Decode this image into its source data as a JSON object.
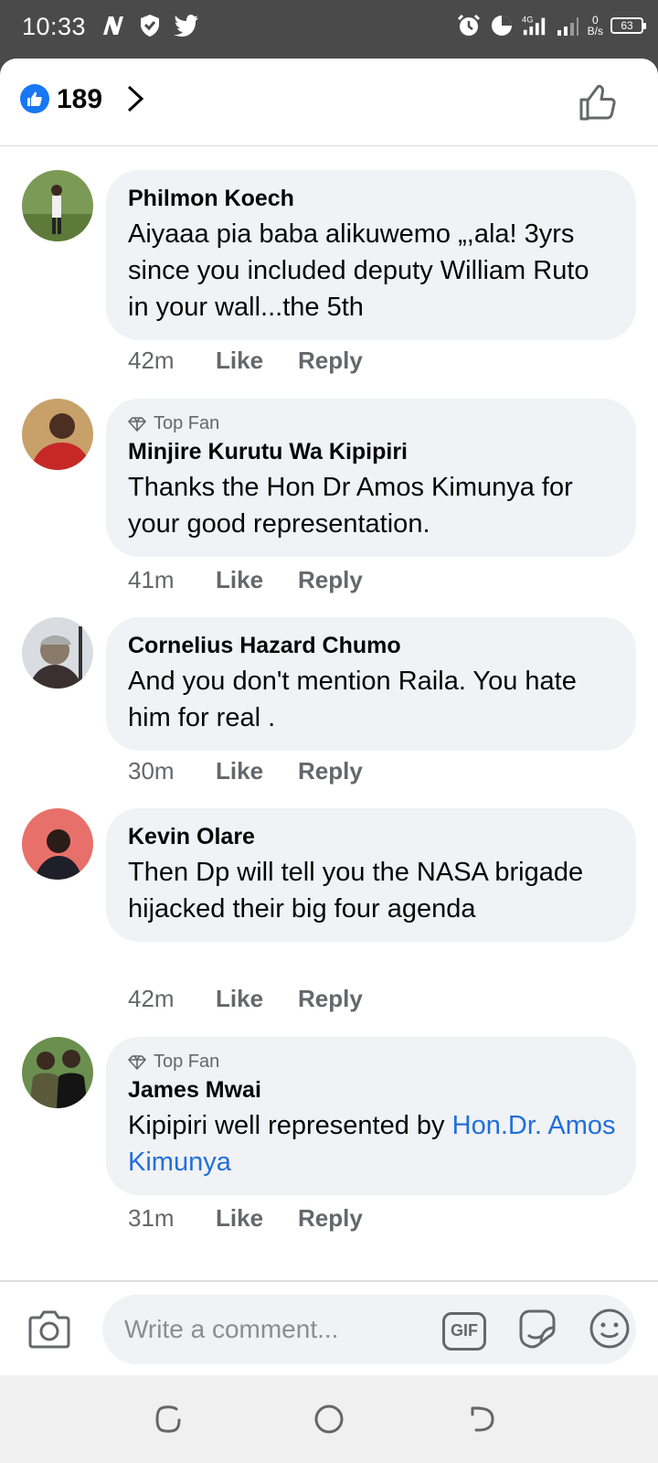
{
  "status_bar": {
    "time": "10:33",
    "left_icons": [
      "n-app-icon",
      "shield-icon",
      "twitter-icon"
    ],
    "right_icons": [
      "alarm-icon",
      "data-saver-icon",
      "signal-4g-icon",
      "signal-icon"
    ],
    "net_speed_value": "0",
    "net_speed_unit": "B/s",
    "battery": "63"
  },
  "reactions": {
    "count": "189"
  },
  "comments": [
    {
      "author": "Philmon Koech",
      "top_fan": false,
      "text": "Aiyaaa pia baba alikuwemo „,ala! 3yrs since you included deputy William Ruto in your wall...the 5th",
      "time": "42m",
      "like": "Like",
      "reply": "Reply"
    },
    {
      "author": "Minjire Kurutu Wa Kipipiri",
      "top_fan": true,
      "badge": "Top Fan",
      "text": "Thanks the Hon Dr Amos Kimunya for your good representation.",
      "time": "41m",
      "like": "Like",
      "reply": "Reply"
    },
    {
      "author": "Cornelius Hazard Chumo",
      "top_fan": false,
      "text": "And you don't mention Raila. You hate him for real .",
      "time": "30m",
      "like": "Like",
      "reply": "Reply"
    },
    {
      "author": "Kevin Olare",
      "top_fan": false,
      "text": "Then Dp will tell you the NASA brigade hijacked their big four agenda",
      "time": "42m",
      "like": "Like",
      "reply": "Reply"
    },
    {
      "author": "James Mwai",
      "top_fan": true,
      "badge": "Top Fan",
      "text": "Kipipiri well represented by ",
      "mention": "Hon.Dr. Amos Kimunya",
      "time": "31m",
      "like": "Like",
      "reply": "Reply"
    }
  ],
  "composer": {
    "placeholder": "Write a comment...",
    "gif_label": "GIF"
  },
  "colors": {
    "accent": "#1877f2",
    "mention": "#216fdb",
    "bubble": "#f0f2f5",
    "secondary_text": "#65676b"
  }
}
